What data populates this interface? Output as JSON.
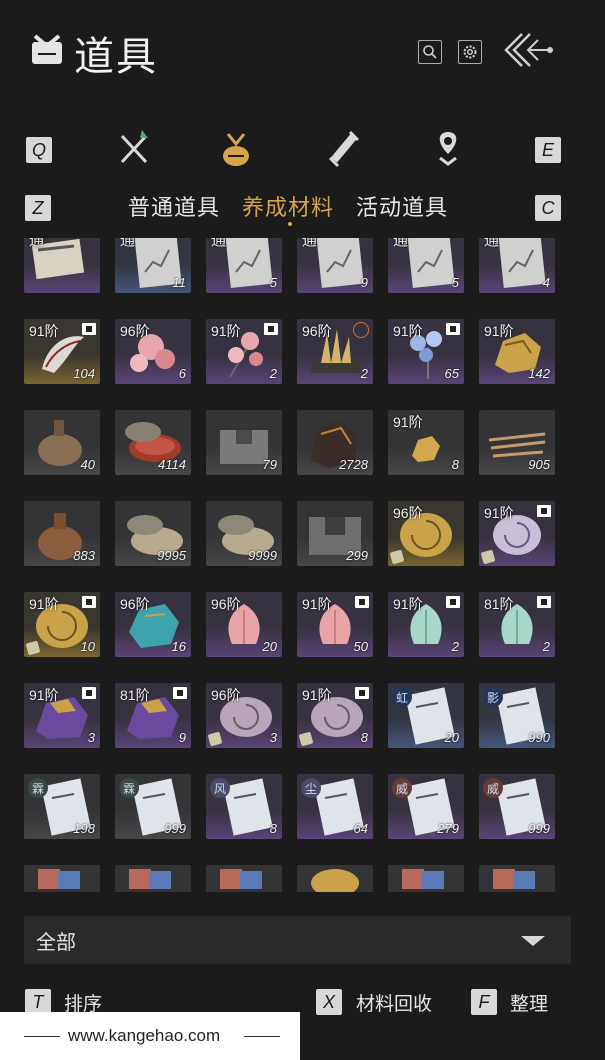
{
  "header": {
    "title": "道具",
    "icons": [
      "inventory-bag-icon",
      "search-icon",
      "gear-icon",
      "back-arrow-icon"
    ]
  },
  "category_tabs": {
    "left_key": "Q",
    "right_key": "E",
    "tabs": [
      "weapons-icon",
      "materials-bag-icon",
      "scroll-icon",
      "location-pin-icon"
    ],
    "active_index": 1
  },
  "sub_tabs": {
    "left_key": "Z",
    "right_key": "C",
    "items": [
      "普通道具",
      "养成材料",
      "活动道具"
    ],
    "active_index": 1
  },
  "items": [
    {
      "row": 0,
      "col": 0,
      "prefix": "通",
      "qty": "",
      "art": "book",
      "bg": "purple"
    },
    {
      "row": 0,
      "col": 1,
      "prefix": "通",
      "qty": "11",
      "art": "map",
      "bg": "blue"
    },
    {
      "row": 0,
      "col": 2,
      "prefix": "通",
      "qty": "5",
      "art": "map",
      "bg": "purple"
    },
    {
      "row": 0,
      "col": 3,
      "prefix": "通",
      "qty": "9",
      "art": "map",
      "bg": "purple"
    },
    {
      "row": 0,
      "col": 4,
      "prefix": "通",
      "qty": "5",
      "art": "map",
      "bg": "purple"
    },
    {
      "row": 0,
      "col": 5,
      "prefix": "通",
      "qty": "4",
      "art": "map",
      "bg": "purple"
    },
    {
      "row": 1,
      "col": 0,
      "level": "91阶",
      "badge": true,
      "qty": "104",
      "art": "wing",
      "bg": "gold"
    },
    {
      "row": 1,
      "col": 1,
      "level": "96阶",
      "qty": "6",
      "art": "pinkflower",
      "bg": "purple"
    },
    {
      "row": 1,
      "col": 2,
      "level": "91阶",
      "badge": true,
      "qty": "2",
      "art": "pinkflower2",
      "bg": "purple"
    },
    {
      "row": 1,
      "col": 3,
      "level": "96阶",
      "target": true,
      "qty": "2",
      "art": "crystal",
      "bg": "purple"
    },
    {
      "row": 1,
      "col": 4,
      "level": "91阶",
      "badge": true,
      "qty": "65",
      "art": "blueflower",
      "bg": "purple"
    },
    {
      "row": 1,
      "col": 5,
      "level": "91阶",
      "qty": "142",
      "art": "goldore",
      "bg": "purple"
    },
    {
      "row": 2,
      "col": 0,
      "qty": "40",
      "art": "flask",
      "bg": "gray"
    },
    {
      "row": 2,
      "col": 1,
      "qty": "4114",
      "art": "redtin",
      "bg": "gray"
    },
    {
      "row": 2,
      "col": 2,
      "qty": "79",
      "art": "stoneblock",
      "bg": "gray"
    },
    {
      "row": 2,
      "col": 3,
      "qty": "2728",
      "art": "darkore",
      "bg": "gray"
    },
    {
      "row": 2,
      "col": 4,
      "level": "91阶",
      "qty": "8",
      "art": "goldnugget",
      "bg": "gray"
    },
    {
      "row": 2,
      "col": 5,
      "qty": "905",
      "art": "sticks",
      "bg": "gray"
    },
    {
      "row": 3,
      "col": 0,
      "qty": "883",
      "art": "gourd",
      "bg": "gray"
    },
    {
      "row": 3,
      "col": 1,
      "qty": "9995",
      "art": "tin",
      "bg": "gray"
    },
    {
      "row": 3,
      "col": 2,
      "qty": "9999",
      "art": "tin",
      "bg": "gray"
    },
    {
      "row": 3,
      "col": 3,
      "qty": "299",
      "art": "stoneblock2",
      "bg": "gray"
    },
    {
      "row": 3,
      "col": 4,
      "level": "96阶",
      "mini": true,
      "qty": "",
      "art": "goldshell",
      "bg": "gold"
    },
    {
      "row": 3,
      "col": 5,
      "level": "91阶",
      "badge": true,
      "mini": true,
      "qty": "",
      "art": "pearlshell",
      "bg": "purple"
    },
    {
      "row": 4,
      "col": 0,
      "level": "91阶",
      "badge": true,
      "mini": true,
      "qty": "10",
      "art": "goldshell",
      "bg": "gold"
    },
    {
      "row": 4,
      "col": 1,
      "level": "96阶",
      "qty": "16",
      "art": "turquoise",
      "bg": "purple"
    },
    {
      "row": 4,
      "col": 2,
      "level": "96阶",
      "qty": "20",
      "art": "pinklotus",
      "bg": "purple"
    },
    {
      "row": 4,
      "col": 3,
      "level": "91阶",
      "badge": true,
      "qty": "50",
      "art": "pinklotus",
      "bg": "purple"
    },
    {
      "row": 4,
      "col": 4,
      "level": "91阶",
      "badge": true,
      "qty": "2",
      "art": "jadelotus",
      "bg": "purple"
    },
    {
      "row": 4,
      "col": 5,
      "level": "81阶",
      "badge": true,
      "qty": "2",
      "art": "jadelotus",
      "bg": "purple"
    },
    {
      "row": 5,
      "col": 0,
      "level": "91阶",
      "badge": true,
      "qty": "3",
      "art": "amethyst",
      "bg": "purple"
    },
    {
      "row": 5,
      "col": 1,
      "level": "81阶",
      "badge": true,
      "qty": "9",
      "art": "amethyst",
      "bg": "purple"
    },
    {
      "row": 5,
      "col": 2,
      "level": "96阶",
      "mini": true,
      "qty": "3",
      "art": "spiralshell",
      "bg": "purple"
    },
    {
      "row": 5,
      "col": 3,
      "level": "91阶",
      "badge": true,
      "mini": true,
      "qty": "8",
      "art": "spiralshell",
      "bg": "purple"
    },
    {
      "row": 5,
      "col": 4,
      "seal": "虹",
      "qty": "20",
      "art": "letter",
      "bg": "blue"
    },
    {
      "row": 5,
      "col": 5,
      "seal": "影",
      "qty": "990",
      "art": "letter",
      "bg": "blue"
    },
    {
      "row": 6,
      "col": 0,
      "seal": "霖",
      "qty": "198",
      "art": "letter",
      "bg": "gray"
    },
    {
      "row": 6,
      "col": 1,
      "seal": "霖",
      "qty": "999",
      "art": "letter",
      "bg": "gray"
    },
    {
      "row": 6,
      "col": 2,
      "seal": "风",
      "qty": "8",
      "art": "letter",
      "bg": "purple"
    },
    {
      "row": 6,
      "col": 3,
      "seal": "尘",
      "qty": "64",
      "art": "letter",
      "bg": "purple"
    },
    {
      "row": 6,
      "col": 4,
      "seal": "威",
      "qty": "279",
      "art": "letter",
      "bg": "purple"
    },
    {
      "row": 6,
      "col": 5,
      "seal": "威",
      "qty": "999",
      "art": "letter",
      "bg": "purple"
    },
    {
      "row": 7,
      "col": 0,
      "qty": "",
      "art": "cards",
      "bg": "gray"
    },
    {
      "row": 7,
      "col": 1,
      "qty": "",
      "art": "cards",
      "bg": "gray"
    },
    {
      "row": 7,
      "col": 2,
      "qty": "",
      "art": "cards",
      "bg": "gray"
    },
    {
      "row": 7,
      "col": 3,
      "qty": "",
      "art": "goldball",
      "bg": "gray"
    },
    {
      "row": 7,
      "col": 4,
      "qty": "",
      "art": "cards",
      "bg": "gray"
    },
    {
      "row": 7,
      "col": 5,
      "qty": "",
      "art": "cards",
      "bg": "gray"
    }
  ],
  "filter": {
    "selected": "全部"
  },
  "bottom_actions": [
    {
      "key": "T",
      "label": "排序"
    },
    {
      "key": "X",
      "label": "材料回收"
    },
    {
      "key": "F",
      "label": "整理"
    }
  ],
  "watermark": {
    "footer_text": "www.kangehao.com"
  },
  "colors": {
    "accent": "#d8a44a",
    "background": "#1b1b1c",
    "rarity_purple": "#6a4c8c",
    "rarity_blue": "#4a5f86",
    "rarity_gold": "#8c7434",
    "rarity_gray": "#4a4a4e"
  }
}
